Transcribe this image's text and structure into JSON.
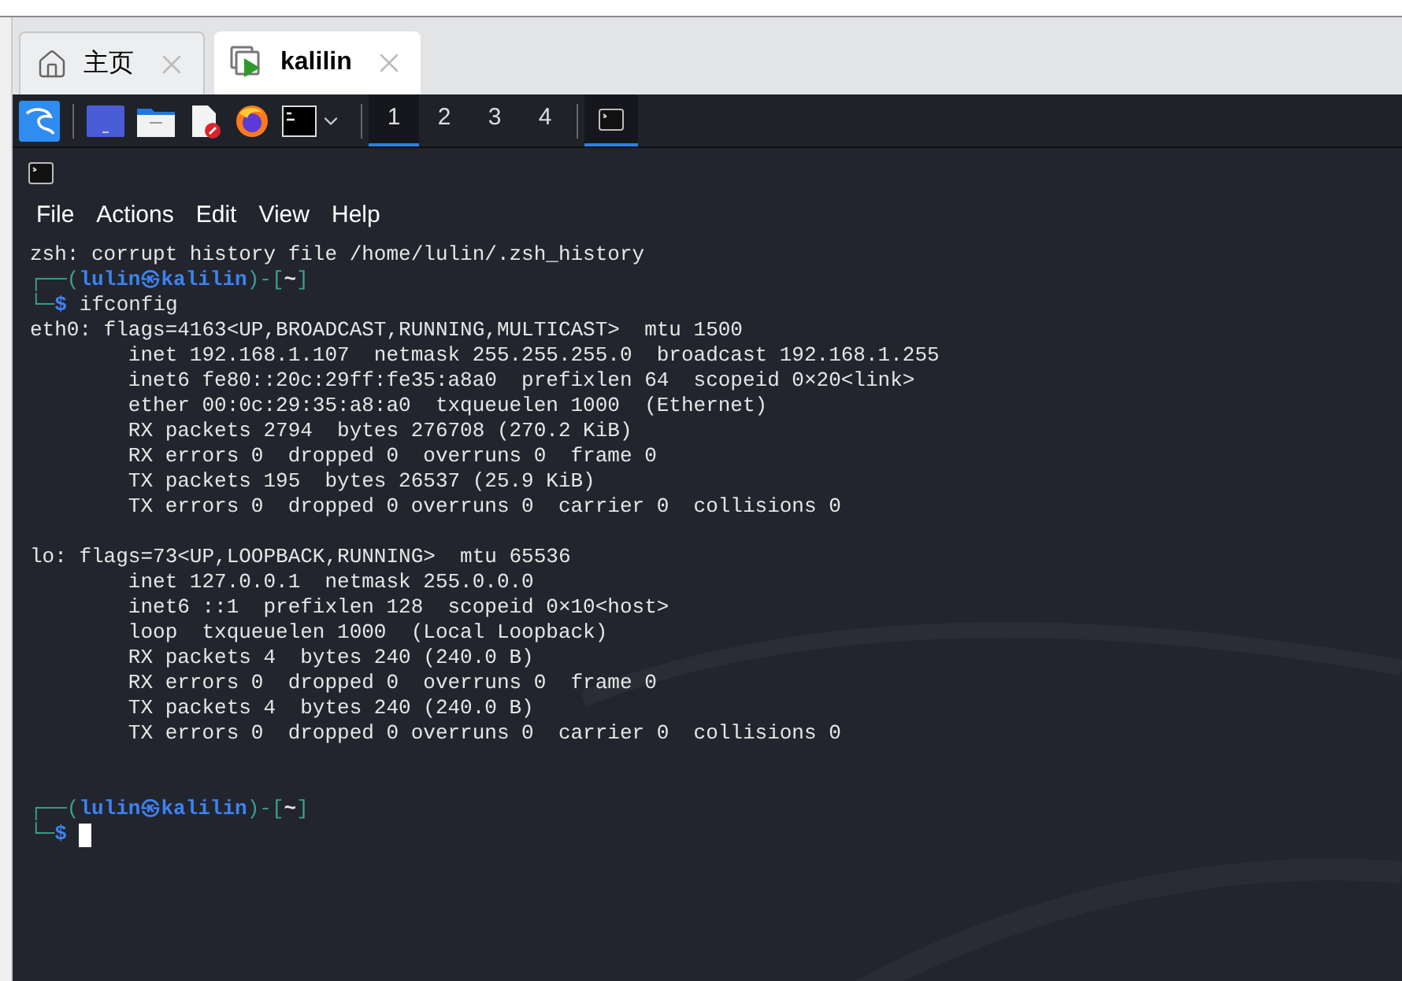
{
  "tabs": [
    {
      "label": "主页",
      "kind": "home",
      "selected": false
    },
    {
      "label": "kalilin",
      "kind": "vm",
      "selected": true
    }
  ],
  "panel": {
    "workspaces": [
      {
        "label": "1",
        "selected": true
      },
      {
        "label": "2",
        "selected": false
      },
      {
        "label": "3",
        "selected": false
      },
      {
        "label": "4",
        "selected": false
      }
    ],
    "windows": [
      {
        "selected": true
      }
    ]
  },
  "menu": [
    "File",
    "Actions",
    "Edit",
    "View",
    "Help"
  ],
  "terminal": {
    "lines": [
      {
        "kind": "output",
        "text": "zsh: corrupt history file /home/lulin/.zsh_history"
      },
      {
        "kind": "prompt",
        "parts": [
          {
            "kind": "frame",
            "text": "┌──("
          },
          {
            "kind": "user",
            "text": "lulin㉿kalilin"
          },
          {
            "kind": "frame",
            "text": ")-["
          },
          {
            "kind": "dir",
            "text": "~"
          },
          {
            "kind": "frame",
            "text": "]"
          }
        ]
      },
      {
        "kind": "command",
        "parts": [
          {
            "kind": "frame",
            "text": "└─"
          },
          {
            "kind": "user",
            "text": "$"
          },
          {
            "kind": "cmd",
            "text": "ifconfig"
          }
        ]
      },
      {
        "kind": "output",
        "text": "eth0: flags=4163<UP,BROADCAST,RUNNING,MULTICAST>  mtu 1500"
      },
      {
        "kind": "output",
        "text": "        inet 192.168.1.107  netmask 255.255.255.0  broadcast 192.168.1.255"
      },
      {
        "kind": "output",
        "text": "        inet6 fe80::20c:29ff:fe35:a8a0  prefixlen 64  scopeid 0×20<link>"
      },
      {
        "kind": "output",
        "text": "        ether 00:0c:29:35:a8:a0  txqueuelen 1000  (Ethernet)"
      },
      {
        "kind": "output",
        "text": "        RX packets 2794  bytes 276708 (270.2 KiB)"
      },
      {
        "kind": "output",
        "text": "        RX errors 0  dropped 0  overruns 0  frame 0"
      },
      {
        "kind": "output",
        "text": "        TX packets 195  bytes 26537 (25.9 KiB)"
      },
      {
        "kind": "output",
        "text": "        TX errors 0  dropped 0 overruns 0  carrier 0  collisions 0"
      },
      {
        "kind": "gap"
      },
      {
        "kind": "output",
        "text": "lo: flags=73<UP,LOOPBACK,RUNNING>  mtu 65536"
      },
      {
        "kind": "output",
        "text": "        inet 127.0.0.1  netmask 255.0.0.0"
      },
      {
        "kind": "output",
        "text": "        inet6 ::1  prefixlen 128  scopeid 0×10<host>"
      },
      {
        "kind": "output",
        "text": "        loop  txqueuelen 1000  (Local Loopback)"
      },
      {
        "kind": "output",
        "text": "        RX packets 4  bytes 240 (240.0 B)"
      },
      {
        "kind": "output",
        "text": "        RX errors 0  dropped 0  overruns 0  frame 0"
      },
      {
        "kind": "output",
        "text": "        TX packets 4  bytes 240 (240.0 B)"
      },
      {
        "kind": "output",
        "text": "        TX errors 0  dropped 0 overruns 0  carrier 0  collisions 0"
      },
      {
        "kind": "gap"
      },
      {
        "kind": "gap"
      },
      {
        "kind": "prompt",
        "parts": [
          {
            "kind": "frame",
            "text": "┌──("
          },
          {
            "kind": "user",
            "text": "lulin㉿kalilin"
          },
          {
            "kind": "frame",
            "text": ")-["
          },
          {
            "kind": "dir",
            "text": "~"
          },
          {
            "kind": "frame",
            "text": "]"
          }
        ]
      },
      {
        "kind": "command",
        "parts": [
          {
            "kind": "frame",
            "text": "└─"
          },
          {
            "kind": "user",
            "text": "$"
          }
        ],
        "cursor": true
      }
    ]
  }
}
